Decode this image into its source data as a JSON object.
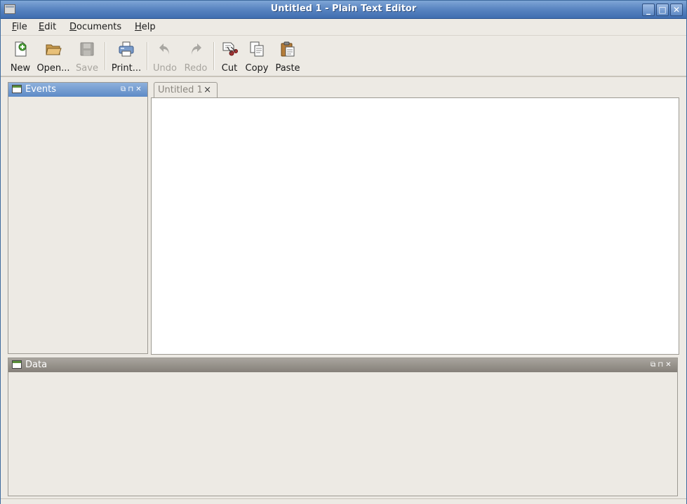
{
  "window": {
    "title": "Untitled 1 - Plain Text Editor",
    "controls": {
      "minimize": "_",
      "maximize": "□",
      "close": "✕"
    }
  },
  "menu": [
    {
      "label": "File",
      "mnemonic": "F",
      "rest": "ile"
    },
    {
      "label": "Edit",
      "mnemonic": "E",
      "rest": "dit"
    },
    {
      "label": "Documents",
      "mnemonic": "D",
      "rest": "ocuments"
    },
    {
      "label": "Help",
      "mnemonic": "H",
      "rest": "elp"
    }
  ],
  "toolbar": {
    "new": "New",
    "open": "Open...",
    "save": "Save",
    "print": "Print...",
    "undo": "Undo",
    "redo": "Redo",
    "cut": "Cut",
    "copy": "Copy",
    "paste": "Paste",
    "disabled": [
      "save",
      "undo",
      "redo"
    ]
  },
  "events_panel": {
    "title": "Events",
    "controls": "⧉ ⊓ ✕"
  },
  "editor": {
    "tab_label": "Untitled 1",
    "tab_close": "×",
    "content": ""
  },
  "data_panel": {
    "title": "Data",
    "controls": "⧉ ⊓ ✕"
  },
  "colors": {
    "titlebar": "#4f7bbb",
    "events_header": "#6d97cf",
    "data_header": "#96928b",
    "background": "#edeae4"
  }
}
